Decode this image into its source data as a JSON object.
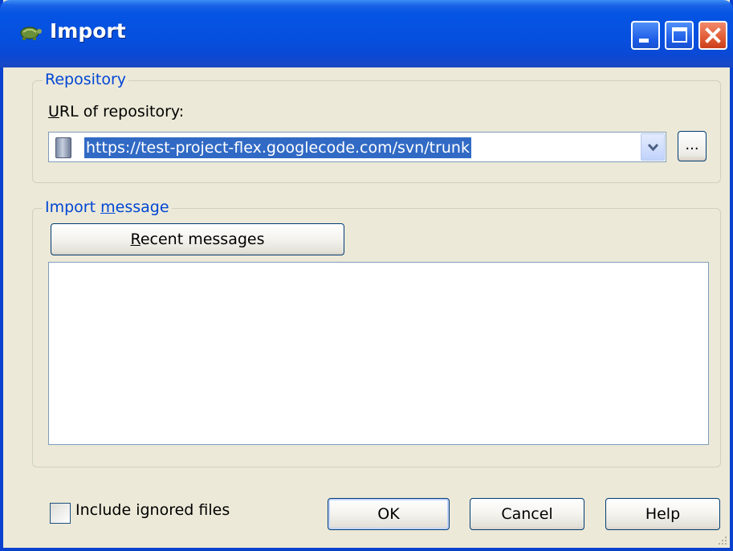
{
  "window": {
    "title": "Import",
    "title_icon": "tortoise-icon",
    "controls": [
      "minimize-icon",
      "maximize-icon",
      "close-icon"
    ]
  },
  "repository": {
    "legend": "Repository",
    "url_label": "URL of repository:",
    "url_value": "https://test-project-flex.googlecode.com/svn/trunk",
    "browse_label": "..."
  },
  "message": {
    "legend_prefix": "Import ",
    "legend_accel": "m",
    "legend_suffix": "essage",
    "recent_accel": "R",
    "recent_rest": "ecent messages",
    "text": ""
  },
  "options": {
    "include_ignored_label": "Include ignored files",
    "include_ignored_checked": false
  },
  "buttons": {
    "ok": "OK",
    "cancel": "Cancel",
    "help": "Help"
  },
  "colors": {
    "titlebar": "#0554e3",
    "dialog_bg": "#ece9d8",
    "group_legend": "#0046d5",
    "selection": "#316ac5",
    "close_button": "#e15b34"
  }
}
